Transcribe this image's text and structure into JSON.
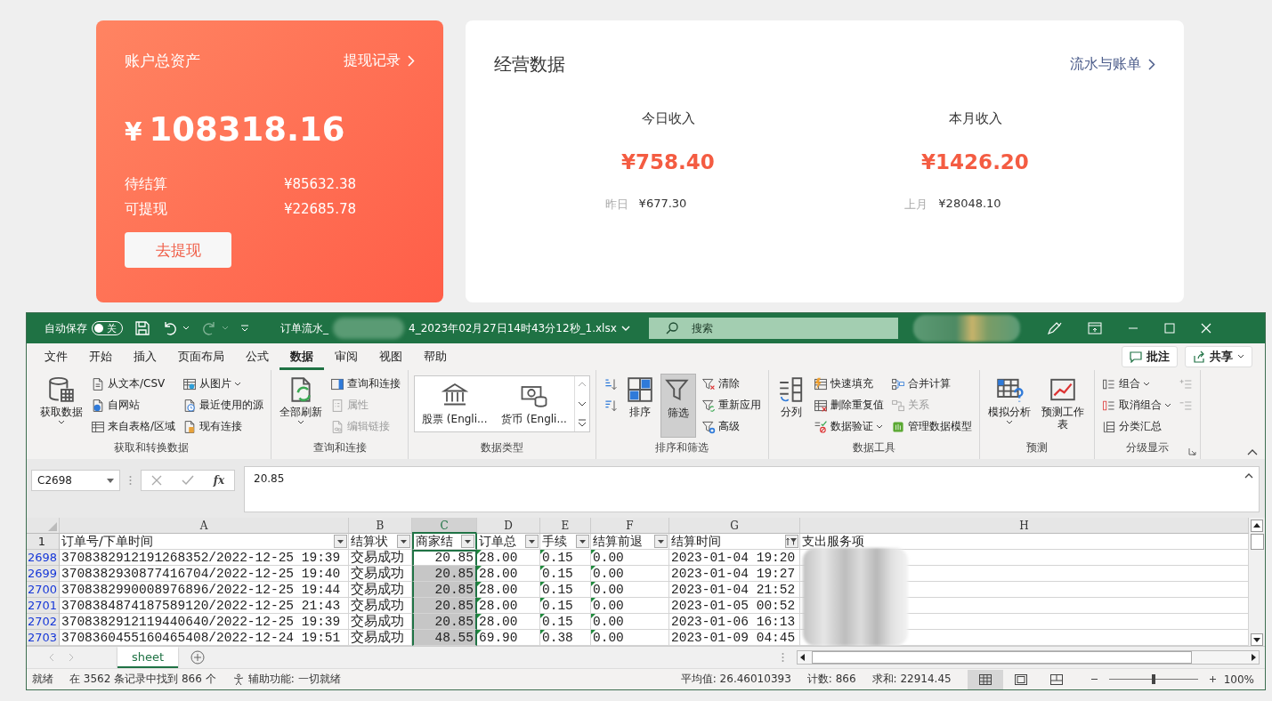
{
  "account_card": {
    "title": "账户总资产",
    "link": "提现记录",
    "currency": "¥",
    "amount": "108318.16",
    "rows": [
      {
        "label": "待结算",
        "value": "¥85632.38"
      },
      {
        "label": "可提现",
        "value": "¥22685.78"
      }
    ],
    "button": "去提现"
  },
  "business_card": {
    "title": "经营数据",
    "link": "流水与账单",
    "stats": [
      {
        "label": "今日收入",
        "value": "¥758.40",
        "compare_label": "昨日",
        "compare_value": "¥677.30"
      },
      {
        "label": "本月收入",
        "value": "¥1426.20",
        "compare_label": "上月",
        "compare_value": "¥28048.10"
      }
    ]
  },
  "excel": {
    "autosave": {
      "label": "自动保存",
      "toggle": "关",
      "on": false
    },
    "title_start": "订单流水_",
    "title_end": "4_2023年02月27日14时43分12秒_1.xlsx",
    "search": {
      "placeholder": "搜索"
    },
    "menu_tabs": [
      {
        "label": "文件",
        "selected": false
      },
      {
        "label": "开始",
        "selected": false
      },
      {
        "label": "插入",
        "selected": false
      },
      {
        "label": "页面布局",
        "selected": false
      },
      {
        "label": "公式",
        "selected": false
      },
      {
        "label": "数据",
        "selected": true
      },
      {
        "label": "审阅",
        "selected": false
      },
      {
        "label": "视图",
        "selected": false
      },
      {
        "label": "帮助",
        "selected": false
      }
    ],
    "comment_button": "批注",
    "share_button": "共享",
    "ribbon_groups": [
      {
        "label": "获取和转换数据",
        "items": [
          {
            "kind": "large",
            "label": "获取数据",
            "dropdown": true,
            "disabled": false,
            "pressed": false
          },
          {
            "kind": "small",
            "label": "从文本/CSV",
            "dropdown": false,
            "disabled": false,
            "pressed": false
          },
          {
            "kind": "small",
            "label": "自网站",
            "dropdown": false,
            "disabled": false,
            "pressed": false
          },
          {
            "kind": "small",
            "label": "来自表格/区域",
            "dropdown": false,
            "disabled": false,
            "pressed": false
          },
          {
            "kind": "small",
            "label": "从图片",
            "dropdown": true,
            "disabled": false,
            "pressed": false
          },
          {
            "kind": "small",
            "label": "最近使用的源",
            "dropdown": false,
            "disabled": false,
            "pressed": false
          },
          {
            "kind": "small",
            "label": "现有连接",
            "dropdown": false,
            "disabled": false,
            "pressed": false
          }
        ]
      },
      {
        "label": "查询和连接",
        "items": [
          {
            "kind": "large",
            "label": "全部刷新",
            "dropdown": true,
            "disabled": false,
            "pressed": false
          },
          {
            "kind": "small",
            "label": "查询和连接",
            "dropdown": false,
            "disabled": false,
            "pressed": false
          },
          {
            "kind": "small",
            "label": "属性",
            "dropdown": false,
            "disabled": true,
            "pressed": false
          },
          {
            "kind": "small",
            "label": "编辑链接",
            "dropdown": false,
            "disabled": true,
            "pressed": false
          }
        ]
      },
      {
        "label": "数据类型",
        "items": [
          {
            "kind": "gallery",
            "label": "股票 (Engli...",
            "dropdown": false,
            "disabled": false,
            "pressed": false
          },
          {
            "kind": "gallery",
            "label": "货币 (Engli...",
            "dropdown": false,
            "disabled": false,
            "pressed": false
          }
        ]
      },
      {
        "label": "排序和筛选",
        "items": [
          {
            "kind": "icon",
            "dropdown": false,
            "disabled": false,
            "pressed": false
          },
          {
            "kind": "icon",
            "dropdown": false,
            "disabled": false,
            "pressed": false
          },
          {
            "kind": "large",
            "label": "排序",
            "dropdown": false,
            "disabled": false,
            "pressed": false
          },
          {
            "kind": "large",
            "label": "筛选",
            "dropdown": false,
            "disabled": false,
            "pressed": true
          },
          {
            "kind": "small",
            "label": "清除",
            "dropdown": false,
            "disabled": false,
            "pressed": false
          },
          {
            "kind": "small",
            "label": "重新应用",
            "dropdown": false,
            "disabled": false,
            "pressed": false
          },
          {
            "kind": "small",
            "label": "高级",
            "dropdown": false,
            "disabled": false,
            "pressed": false
          }
        ]
      },
      {
        "label": "数据工具",
        "items": [
          {
            "kind": "large",
            "label": "分列",
            "dropdown": false,
            "disabled": false,
            "pressed": false
          },
          {
            "kind": "small",
            "label": "快速填充",
            "dropdown": false,
            "disabled": false,
            "pressed": false
          },
          {
            "kind": "small",
            "label": "删除重复值",
            "dropdown": false,
            "disabled": false,
            "pressed": false
          },
          {
            "kind": "small",
            "label": "数据验证",
            "dropdown": true,
            "disabled": false,
            "pressed": false
          },
          {
            "kind": "small",
            "label": "合并计算",
            "dropdown": false,
            "disabled": false,
            "pressed": false
          },
          {
            "kind": "small",
            "label": "关系",
            "dropdown": false,
            "disabled": true,
            "pressed": false
          },
          {
            "kind": "small",
            "label": "管理数据模型",
            "dropdown": false,
            "disabled": false,
            "pressed": false
          }
        ]
      },
      {
        "label": "预测",
        "items": [
          {
            "kind": "large",
            "label": "模拟分析",
            "dropdown": true,
            "disabled": false,
            "pressed": false
          },
          {
            "kind": "large",
            "label": "预测工作表",
            "dropdown": false,
            "disabled": false,
            "pressed": false
          }
        ]
      },
      {
        "label": "分级显示",
        "items": [
          {
            "kind": "small",
            "label": "组合",
            "dropdown": true,
            "disabled": false,
            "pressed": false
          },
          {
            "kind": "small",
            "label": "取消组合",
            "dropdown": true,
            "disabled": false,
            "pressed": false
          },
          {
            "kind": "small",
            "label": "分类汇总",
            "dropdown": false,
            "disabled": false,
            "pressed": false
          },
          {
            "kind": "icon",
            "dropdown": false,
            "disabled": true,
            "pressed": false
          },
          {
            "kind": "icon",
            "dropdown": false,
            "disabled": true,
            "pressed": false
          }
        ]
      }
    ],
    "formula_bar": {
      "name_box": "C2698",
      "function_label": "fx",
      "value": "20.85"
    },
    "sheet": {
      "columns": [
        {
          "letter": "A",
          "header": "订单号/下单时间",
          "has_filter": true,
          "filtered": false,
          "selected": false,
          "number_as_text": false,
          "right_aligned": false
        },
        {
          "letter": "B",
          "header": "结算状",
          "has_filter": true,
          "filtered": false,
          "selected": false,
          "number_as_text": false,
          "right_aligned": false
        },
        {
          "letter": "C",
          "header": "商家结",
          "has_filter": true,
          "filtered": false,
          "selected": true,
          "number_as_text": false,
          "right_aligned": true
        },
        {
          "letter": "D",
          "header": "订单总",
          "has_filter": true,
          "filtered": false,
          "selected": false,
          "number_as_text": true,
          "right_aligned": false
        },
        {
          "letter": "E",
          "header": "手续",
          "has_filter": true,
          "filtered": false,
          "selected": false,
          "number_as_text": true,
          "right_aligned": false
        },
        {
          "letter": "F",
          "header": "结算前退",
          "has_filter": true,
          "filtered": false,
          "selected": false,
          "number_as_text": true,
          "right_aligned": false
        },
        {
          "letter": "G",
          "header": "结算时间",
          "has_filter": true,
          "filtered": true,
          "selected": false,
          "number_as_text": false,
          "right_aligned": false
        },
        {
          "letter": "H",
          "header": "支出服务项",
          "has_filter": false,
          "filtered": false,
          "selected": false,
          "number_as_text": false,
          "right_aligned": false
        }
      ],
      "header_row": "1",
      "rows": [
        {
          "number": "2698",
          "active": true,
          "cells": [
            "3708382912191268352/2022-12-25 19:39",
            "交易成功",
            "20.85",
            "28.00",
            "0.15",
            "0.00",
            "2023-01-04 19:20"
          ]
        },
        {
          "number": "2699",
          "active": false,
          "cells": [
            "3708382930877416704/2022-12-25 19:40",
            "交易成功",
            "20.85",
            "28.00",
            "0.15",
            "0.00",
            "2023-01-04 19:27"
          ]
        },
        {
          "number": "2700",
          "active": false,
          "cells": [
            "3708382990008976896/2022-12-25 19:44",
            "交易成功",
            "20.85",
            "28.00",
            "0.15",
            "0.00",
            "2023-01-04 21:52"
          ]
        },
        {
          "number": "2701",
          "active": false,
          "cells": [
            "3708384874187589120/2022-12-25 21:43",
            "交易成功",
            "20.85",
            "28.00",
            "0.15",
            "0.00",
            "2023-01-05 00:52"
          ]
        },
        {
          "number": "2702",
          "active": false,
          "cells": [
            "3708382912119440640/2022-12-25 19:39",
            "交易成功",
            "20.85",
            "28.00",
            "0.15",
            "0.00",
            "2023-01-06 16:13"
          ]
        },
        {
          "number": "2703",
          "active": false,
          "cells": [
            "3708360455160465408/2022-12-24 19:51",
            "交易成功",
            "48.55",
            "69.90",
            "0.38",
            "0.00",
            "2023-01-09 04:45"
          ]
        }
      ]
    },
    "sheet_tabs": [
      {
        "label": "sheet",
        "selected": true
      }
    ],
    "status_bar": {
      "ready": "就绪",
      "found": "在 3562 条记录中找到 866 个",
      "accessibility": "辅助功能: 一切就绪",
      "average": "平均值: 26.46010393",
      "count": "计数: 866",
      "sum": "求和: 22914.45",
      "views": [
        {
          "selected": true
        },
        {
          "selected": false
        },
        {
          "selected": false
        }
      ],
      "zoom": {
        "level": 0.5,
        "label": "100%"
      }
    }
  }
}
